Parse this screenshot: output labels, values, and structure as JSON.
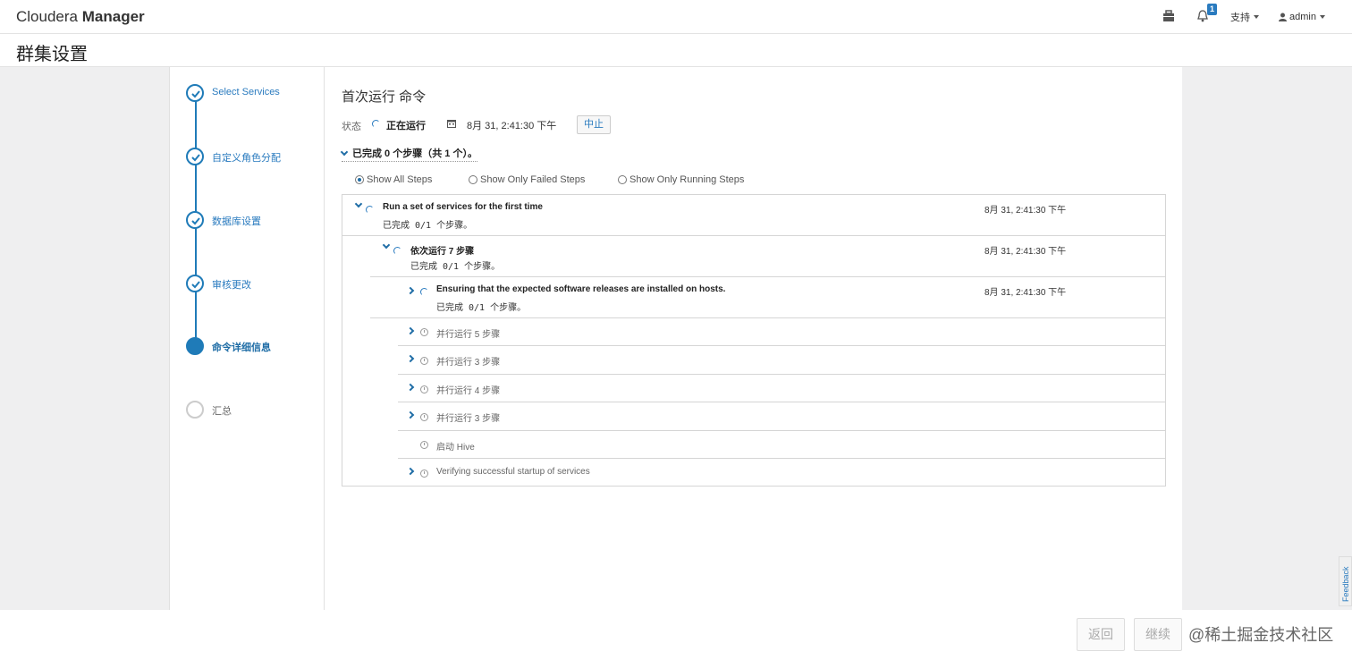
{
  "app": {
    "brand_light": "Cloudera",
    "brand_bold": "Manager"
  },
  "nav": {
    "notification_count": "1",
    "support": "支持",
    "user": "admin"
  },
  "page": {
    "title": "群集设置"
  },
  "wizard": {
    "steps": [
      {
        "label": "Select Services",
        "state": "done"
      },
      {
        "label": "自定义角色分配",
        "state": "done"
      },
      {
        "label": "数据库设置",
        "state": "done"
      },
      {
        "label": "审核更改",
        "state": "done"
      },
      {
        "label": "命令详细信息",
        "state": "active"
      },
      {
        "label": "汇总",
        "state": "pending"
      }
    ]
  },
  "command": {
    "title": "首次运行 命令",
    "status_label": "状态",
    "status_value": "正在运行",
    "time": "8月 31, 2:41:30 下午",
    "abort_label": "中止",
    "summary": "已完成 0 个步骤（共 1 个）。"
  },
  "filters": [
    {
      "label": "Show All Steps",
      "selected": true
    },
    {
      "label": "Show Only Failed Steps",
      "selected": false
    },
    {
      "label": "Show Only Running Steps",
      "selected": false
    }
  ],
  "steps": {
    "root": {
      "title": "Run a set of services for the first time",
      "sub": "已完成 0/1 个步骤。",
      "time": "8月 31, 2:41:30 下午"
    },
    "seq": {
      "title": "依次运行 7 步骤",
      "sub": "已完成 0/1 个步骤。",
      "time": "8月 31, 2:41:30 下午"
    },
    "ensure": {
      "title": "Ensuring that the expected software releases are installed on hosts.",
      "sub": "已完成 0/1 个步骤。",
      "time": "8月 31, 2:41:30 下午"
    },
    "pending": [
      "并行运行 5 步骤",
      "并行运行 3 步骤",
      "并行运行 4 步骤",
      "并行运行 3 步骤",
      "启动 Hive",
      "Verifying successful startup of services"
    ]
  },
  "footer": {
    "back": "返回",
    "continue": "继续",
    "watermark": "@稀土掘金技术社区"
  },
  "feedback": "Feedback",
  "colors": {
    "accent": "#1f7bb8",
    "link": "#2a7bbf",
    "page_bg": "#efeff0"
  }
}
